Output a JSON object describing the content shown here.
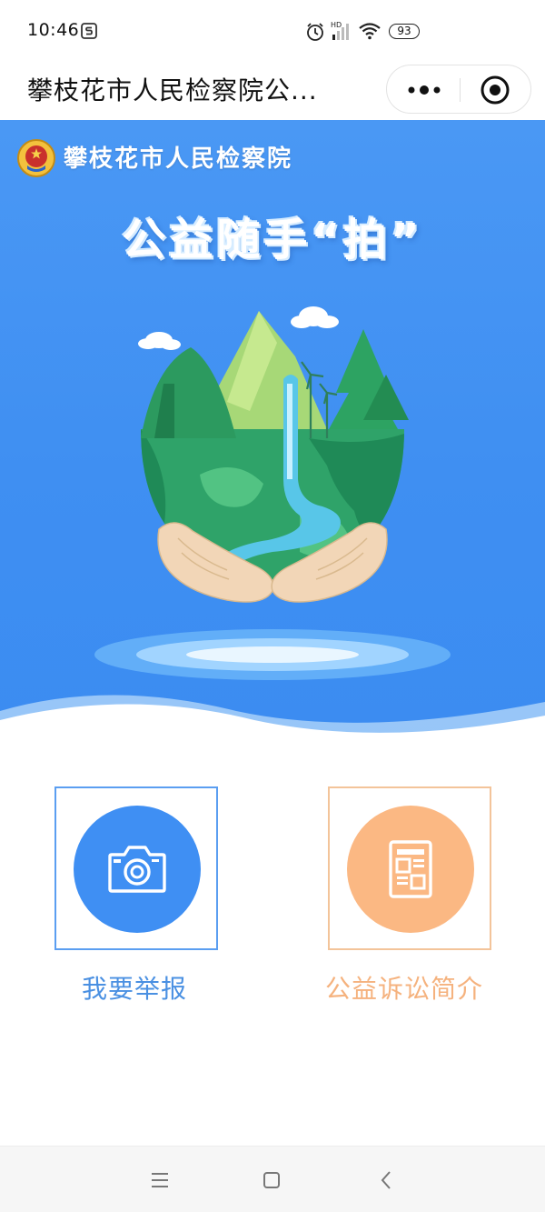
{
  "status_bar": {
    "time": "10:46",
    "network_label": "HD",
    "battery": "93"
  },
  "titlebar": {
    "title": "攀枝花市人民检察院公..."
  },
  "banner": {
    "org_name": "攀枝花市人民检察院",
    "headline": "公益随手“拍”"
  },
  "actions": [
    {
      "label": "我要举报",
      "icon": "camera-icon",
      "color": "#3f8ff3"
    },
    {
      "label": "公益诉讼简介",
      "icon": "document-icon",
      "color": "#fbb883"
    }
  ],
  "colors": {
    "primary_blue": "#3f8ff3",
    "accent_orange": "#fbb883"
  }
}
